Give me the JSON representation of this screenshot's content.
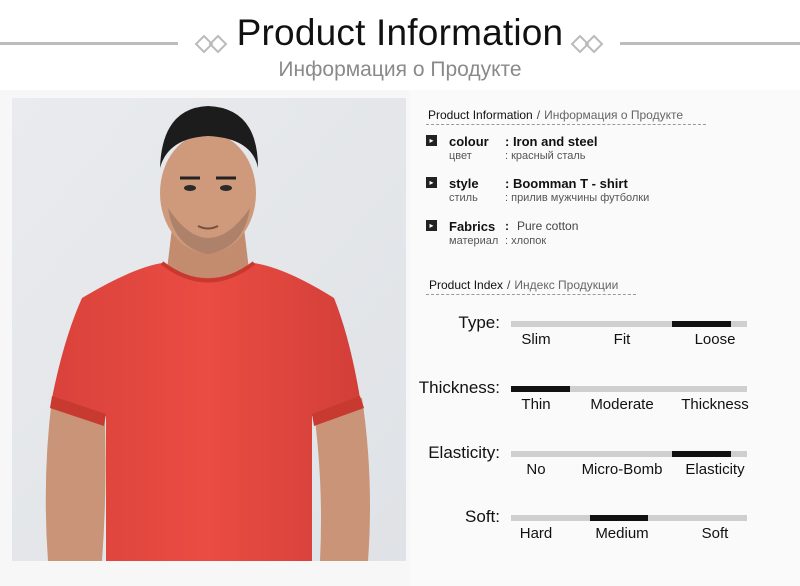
{
  "header": {
    "title": "Product Information",
    "subtitle": "Информация о Продукте"
  },
  "product_info": {
    "heading_en": "Product Information",
    "heading_sep": "/",
    "heading_ru": "Информация о Продукте",
    "attributes": [
      {
        "key_en": "colour",
        "value_en": ": Iron and steel",
        "key_ru": "цвет",
        "value_ru": ": красный  сталь"
      },
      {
        "key_en": "style",
        "value_en": ": Boomman T - shirt",
        "key_ru": "стиль",
        "value_ru": ": прилив мужчины  футболки"
      },
      {
        "key_en": "Fabrics",
        "colon": ":",
        "value_en": "Pure cotton",
        "key_ru": "материал",
        "value_ru": ":  хлопок"
      }
    ]
  },
  "product_index": {
    "heading_en": "Product Index",
    "heading_sep": "/",
    "heading_ru": "Индекс Продукции",
    "scales": [
      {
        "label": "Type:",
        "options": [
          "Slim",
          "Fit",
          "Loose"
        ],
        "selected": 2
      },
      {
        "label": "Thickness:",
        "options": [
          "Thin",
          "Moderate",
          "Thickness"
        ],
        "selected": 0
      },
      {
        "label": "Elasticity:",
        "options": [
          "No",
          "Micro-Bomb",
          "Elasticity"
        ],
        "selected": 2
      },
      {
        "label": "Soft:",
        "options": [
          "Hard",
          "Medium",
          "Soft"
        ],
        "selected": 1
      }
    ]
  },
  "colors": {
    "shirt": "#e8473f",
    "track": "#cfcfcf",
    "active": "#111111"
  }
}
